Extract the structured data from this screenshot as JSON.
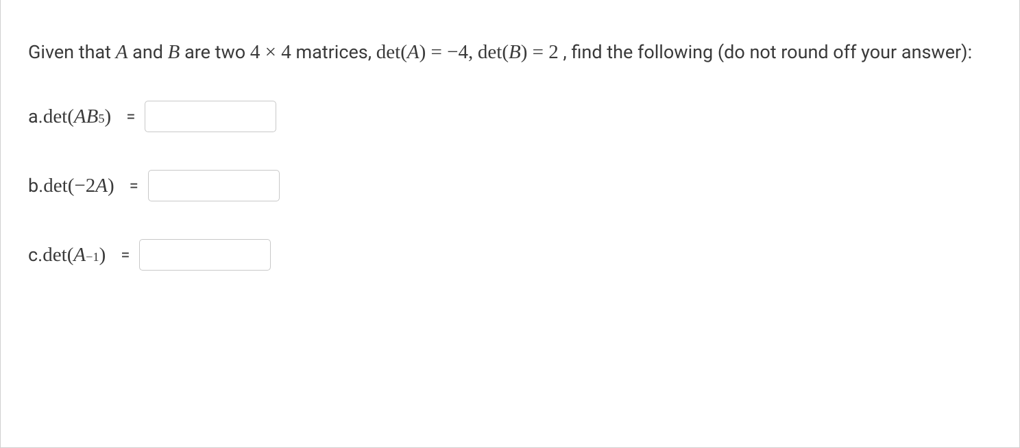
{
  "prompt": {
    "p1": "Given that ",
    "A": "A",
    "p2": " and ",
    "B": "B",
    "p3": " are two ",
    "dim": "4 × 4",
    "p4": "  matrices, ",
    "detA_lhs_det": "det(",
    "detA_lhs_var": "A",
    "detA_lhs_close": ") = ",
    "detA_val": "−4,",
    "spacer": "   ",
    "detB_lhs_det": "det(",
    "detB_lhs_var": "B",
    "detB_lhs_close": ") = ",
    "detB_val": "2",
    "p5": "  , find the following (do not round off your answer):"
  },
  "parts": {
    "a": {
      "letter": "a. ",
      "det": "det(",
      "expr_A": "A",
      "expr_B": "B",
      "sup": "5",
      "close": ")"
    },
    "b": {
      "letter": "b. ",
      "det": "det(",
      "neg": "−2",
      "expr_A": "A",
      "close": ")"
    },
    "c": {
      "letter": "c. ",
      "det": "det(",
      "expr_A": "A",
      "sup": "−1",
      "close": ")"
    }
  },
  "equals": "="
}
